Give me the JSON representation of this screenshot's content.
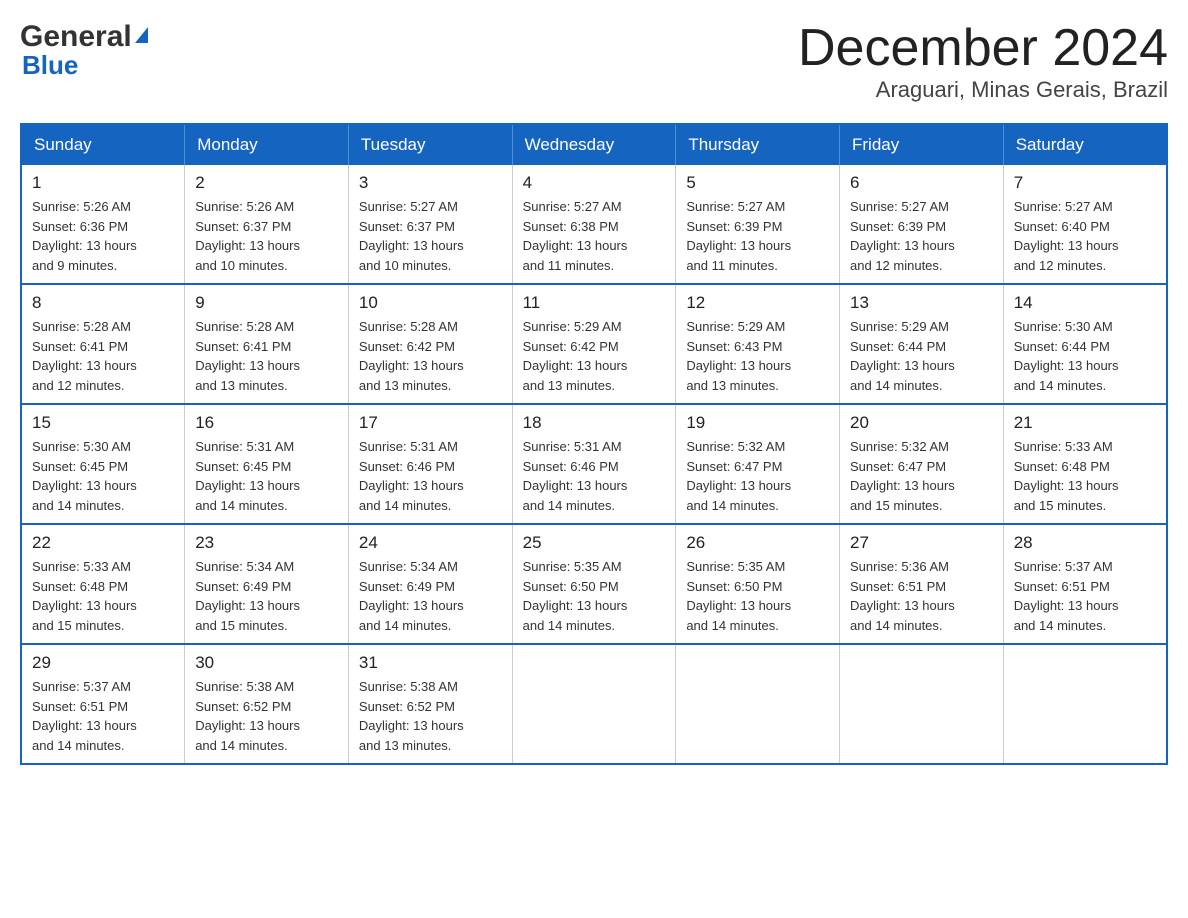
{
  "logo": {
    "general": "General",
    "blue": "Blue",
    "arrow": "▶"
  },
  "title": "December 2024",
  "location": "Araguari, Minas Gerais, Brazil",
  "days_of_week": [
    "Sunday",
    "Monday",
    "Tuesday",
    "Wednesday",
    "Thursday",
    "Friday",
    "Saturday"
  ],
  "weeks": [
    [
      {
        "day": "1",
        "sunrise": "5:26 AM",
        "sunset": "6:36 PM",
        "daylight": "13 hours and 9 minutes."
      },
      {
        "day": "2",
        "sunrise": "5:26 AM",
        "sunset": "6:37 PM",
        "daylight": "13 hours and 10 minutes."
      },
      {
        "day": "3",
        "sunrise": "5:27 AM",
        "sunset": "6:37 PM",
        "daylight": "13 hours and 10 minutes."
      },
      {
        "day": "4",
        "sunrise": "5:27 AM",
        "sunset": "6:38 PM",
        "daylight": "13 hours and 11 minutes."
      },
      {
        "day": "5",
        "sunrise": "5:27 AM",
        "sunset": "6:39 PM",
        "daylight": "13 hours and 11 minutes."
      },
      {
        "day": "6",
        "sunrise": "5:27 AM",
        "sunset": "6:39 PM",
        "daylight": "13 hours and 12 minutes."
      },
      {
        "day": "7",
        "sunrise": "5:27 AM",
        "sunset": "6:40 PM",
        "daylight": "13 hours and 12 minutes."
      }
    ],
    [
      {
        "day": "8",
        "sunrise": "5:28 AM",
        "sunset": "6:41 PM",
        "daylight": "13 hours and 12 minutes."
      },
      {
        "day": "9",
        "sunrise": "5:28 AM",
        "sunset": "6:41 PM",
        "daylight": "13 hours and 13 minutes."
      },
      {
        "day": "10",
        "sunrise": "5:28 AM",
        "sunset": "6:42 PM",
        "daylight": "13 hours and 13 minutes."
      },
      {
        "day": "11",
        "sunrise": "5:29 AM",
        "sunset": "6:42 PM",
        "daylight": "13 hours and 13 minutes."
      },
      {
        "day": "12",
        "sunrise": "5:29 AM",
        "sunset": "6:43 PM",
        "daylight": "13 hours and 13 minutes."
      },
      {
        "day": "13",
        "sunrise": "5:29 AM",
        "sunset": "6:44 PM",
        "daylight": "13 hours and 14 minutes."
      },
      {
        "day": "14",
        "sunrise": "5:30 AM",
        "sunset": "6:44 PM",
        "daylight": "13 hours and 14 minutes."
      }
    ],
    [
      {
        "day": "15",
        "sunrise": "5:30 AM",
        "sunset": "6:45 PM",
        "daylight": "13 hours and 14 minutes."
      },
      {
        "day": "16",
        "sunrise": "5:31 AM",
        "sunset": "6:45 PM",
        "daylight": "13 hours and 14 minutes."
      },
      {
        "day": "17",
        "sunrise": "5:31 AM",
        "sunset": "6:46 PM",
        "daylight": "13 hours and 14 minutes."
      },
      {
        "day": "18",
        "sunrise": "5:31 AM",
        "sunset": "6:46 PM",
        "daylight": "13 hours and 14 minutes."
      },
      {
        "day": "19",
        "sunrise": "5:32 AM",
        "sunset": "6:47 PM",
        "daylight": "13 hours and 14 minutes."
      },
      {
        "day": "20",
        "sunrise": "5:32 AM",
        "sunset": "6:47 PM",
        "daylight": "13 hours and 15 minutes."
      },
      {
        "day": "21",
        "sunrise": "5:33 AM",
        "sunset": "6:48 PM",
        "daylight": "13 hours and 15 minutes."
      }
    ],
    [
      {
        "day": "22",
        "sunrise": "5:33 AM",
        "sunset": "6:48 PM",
        "daylight": "13 hours and 15 minutes."
      },
      {
        "day": "23",
        "sunrise": "5:34 AM",
        "sunset": "6:49 PM",
        "daylight": "13 hours and 15 minutes."
      },
      {
        "day": "24",
        "sunrise": "5:34 AM",
        "sunset": "6:49 PM",
        "daylight": "13 hours and 14 minutes."
      },
      {
        "day": "25",
        "sunrise": "5:35 AM",
        "sunset": "6:50 PM",
        "daylight": "13 hours and 14 minutes."
      },
      {
        "day": "26",
        "sunrise": "5:35 AM",
        "sunset": "6:50 PM",
        "daylight": "13 hours and 14 minutes."
      },
      {
        "day": "27",
        "sunrise": "5:36 AM",
        "sunset": "6:51 PM",
        "daylight": "13 hours and 14 minutes."
      },
      {
        "day": "28",
        "sunrise": "5:37 AM",
        "sunset": "6:51 PM",
        "daylight": "13 hours and 14 minutes."
      }
    ],
    [
      {
        "day": "29",
        "sunrise": "5:37 AM",
        "sunset": "6:51 PM",
        "daylight": "13 hours and 14 minutes."
      },
      {
        "day": "30",
        "sunrise": "5:38 AM",
        "sunset": "6:52 PM",
        "daylight": "13 hours and 14 minutes."
      },
      {
        "day": "31",
        "sunrise": "5:38 AM",
        "sunset": "6:52 PM",
        "daylight": "13 hours and 13 minutes."
      },
      null,
      null,
      null,
      null
    ]
  ],
  "labels": {
    "sunrise": "Sunrise:",
    "sunset": "Sunset:",
    "daylight": "Daylight:"
  }
}
